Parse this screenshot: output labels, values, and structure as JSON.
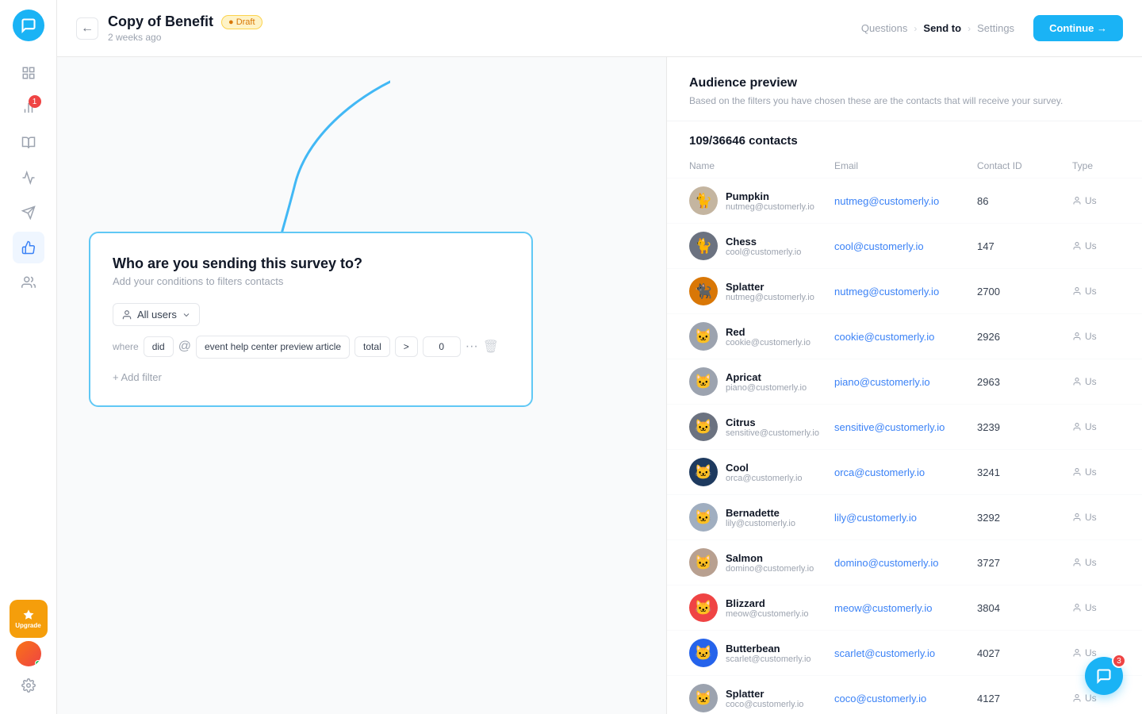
{
  "sidebar": {
    "logo_icon": "chat-icon",
    "items": [
      {
        "id": "grid",
        "icon": "grid-icon",
        "active": false,
        "badge": null
      },
      {
        "id": "activity",
        "icon": "activity-icon",
        "active": false,
        "badge": "1"
      },
      {
        "id": "book",
        "icon": "book-icon",
        "active": false,
        "badge": null
      },
      {
        "id": "chart",
        "icon": "chart-icon",
        "active": false,
        "badge": null
      },
      {
        "id": "send",
        "icon": "send-icon",
        "active": false,
        "badge": null
      },
      {
        "id": "thumb",
        "icon": "thumb-icon",
        "active": true,
        "badge": null
      },
      {
        "id": "users",
        "icon": "users-icon",
        "active": false,
        "badge": null
      }
    ],
    "upgrade_label": "Upgrade"
  },
  "header": {
    "title": "Copy of Benefit",
    "draft_label": "● Draft",
    "subtitle": "2 weeks ago",
    "back_label": "←",
    "nav_steps": [
      {
        "label": "Questions",
        "active": false
      },
      {
        "label": "Send to",
        "active": true
      },
      {
        "label": "Settings",
        "active": false
      }
    ],
    "continue_label": "Continue →"
  },
  "left_panel": {
    "filter_box": {
      "title": "Who are you sending this survey to?",
      "subtitle": "Add your conditions to filters contacts",
      "audience_selector_label": "All users",
      "audience_icon": "user-icon",
      "where_label": "where",
      "condition_did": "did",
      "condition_event": "event help center preview article",
      "condition_total": "total",
      "condition_operator": ">",
      "condition_value": "0",
      "add_filter_label": "+ Add filter"
    }
  },
  "right_panel": {
    "title": "Audience preview",
    "description": "Based on the filters you have chosen these are the contacts that will receive your survey.",
    "contacts_count": "109/36646 contacts",
    "columns": [
      "Name",
      "Email",
      "Contact ID",
      "Type"
    ],
    "contacts": [
      {
        "name": "Pumpkin",
        "email_sub": "nutmeg@customerly.io",
        "email": "nutmeg@customerly.io",
        "id": "86",
        "type": "Us",
        "avatar_color": "#d1d5db",
        "avatar_text": "🐈"
      },
      {
        "name": "Chess",
        "email_sub": "cool@customerly.io",
        "email": "cool@customerly.io",
        "id": "147",
        "type": "Us",
        "avatar_color": "#d1d5db",
        "avatar_text": "🐈"
      },
      {
        "name": "Splatter",
        "email_sub": "nutmeg@customerly.io",
        "email": "nutmeg@customerly.io",
        "id": "2700",
        "type": "Us",
        "avatar_color": "#d97706",
        "avatar_text": "🐈"
      },
      {
        "name": "Red",
        "email_sub": "cookie@customerly.io",
        "email": "cookie@customerly.io",
        "id": "2926",
        "type": "Us",
        "avatar_color": "#d1d5db",
        "avatar_text": "🐱"
      },
      {
        "name": "Apricat",
        "email_sub": "piano@customerly.io",
        "email": "piano@customerly.io",
        "id": "2963",
        "type": "Us",
        "avatar_color": "#d1d5db",
        "avatar_text": "🐱"
      },
      {
        "name": "Citrus",
        "email_sub": "sensitive@customerly.io",
        "email": "sensitive@customerly.io",
        "id": "3239",
        "type": "Us",
        "avatar_color": "#d1d5db",
        "avatar_text": "🐱"
      },
      {
        "name": "Cool",
        "email_sub": "orca@customerly.io",
        "email": "orca@customerly.io",
        "id": "3241",
        "type": "Us",
        "avatar_color": "#1e3a5f",
        "avatar_text": "🐱"
      },
      {
        "name": "Bernadette",
        "email_sub": "lily@customerly.io",
        "email": "lily@customerly.io",
        "id": "3292",
        "type": "Us",
        "avatar_color": "#d1d5db",
        "avatar_text": "🐱"
      },
      {
        "name": "Salmon",
        "email_sub": "domino@customerly.io",
        "email": "domino@customerly.io",
        "id": "3727",
        "type": "Us",
        "avatar_color": "#d1d5db",
        "avatar_text": "🐱"
      },
      {
        "name": "Blizzard",
        "email_sub": "meow@customerly.io",
        "email": "meow@customerly.io",
        "id": "3804",
        "type": "Us",
        "avatar_color": "#e11d48",
        "avatar_text": "🐱"
      },
      {
        "name": "Butterbean",
        "email_sub": "scarlet@customerly.io",
        "email": "scarlet@customerly.io",
        "id": "4027",
        "type": "Us",
        "avatar_color": "#2563eb",
        "avatar_text": "🐱"
      },
      {
        "name": "Splatter",
        "email_sub": "coco@customerly.io",
        "email": "coco@customerly.io",
        "id": "4127",
        "type": "Us",
        "avatar_color": "#d1d5db",
        "avatar_text": "🐱"
      }
    ]
  },
  "chat_bubble": {
    "badge": "3"
  }
}
